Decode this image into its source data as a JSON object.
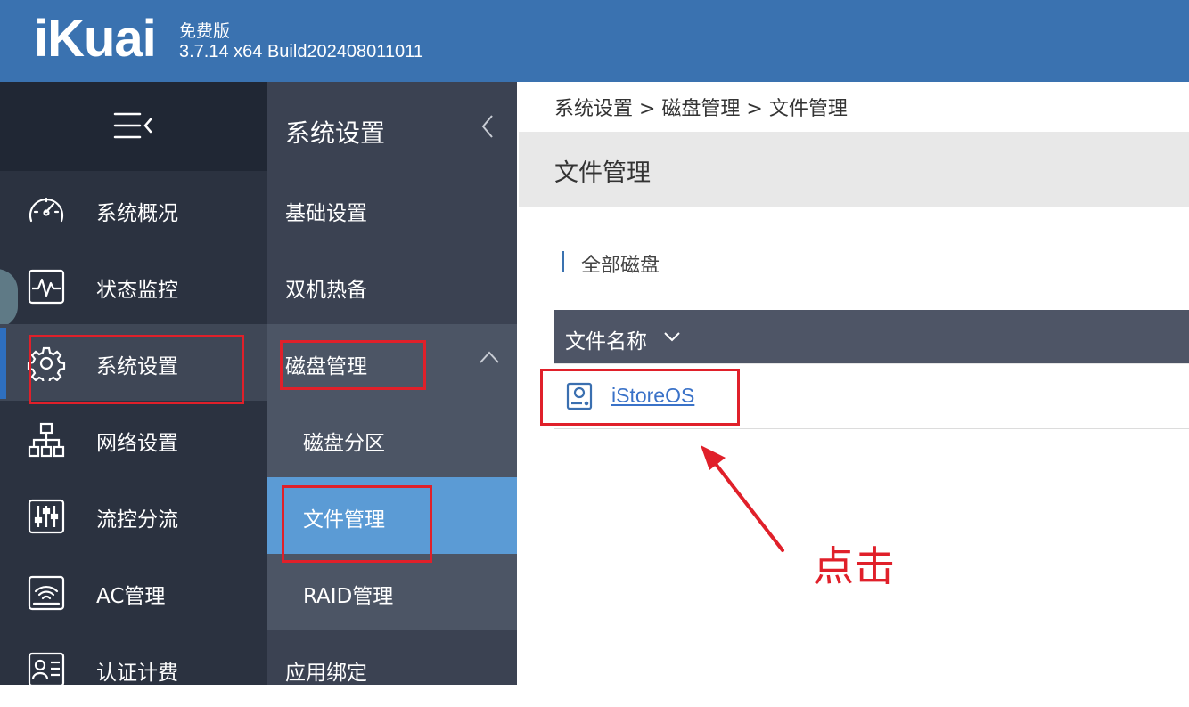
{
  "header": {
    "logo": "iKuai",
    "edition": "免费版",
    "build": "3.7.14 x64 Build202408011011"
  },
  "sidebar": {
    "items": [
      {
        "label": "系统概况",
        "icon": "dashboard-icon"
      },
      {
        "label": "状态监控",
        "icon": "monitor-icon"
      },
      {
        "label": "系统设置",
        "icon": "gear-icon"
      },
      {
        "label": "网络设置",
        "icon": "network-icon"
      },
      {
        "label": "流控分流",
        "icon": "sliders-icon"
      },
      {
        "label": "AC管理",
        "icon": "wifi-ac-icon"
      },
      {
        "label": "认证计费",
        "icon": "id-card-icon"
      }
    ]
  },
  "submenu": {
    "title": "系统设置",
    "items": [
      "基础设置",
      "双机热备",
      "磁盘管理",
      "磁盘分区",
      "文件管理",
      "RAID管理",
      "应用绑定"
    ]
  },
  "main": {
    "breadcrumb": "系统设置 > 磁盘管理 > 文件管理",
    "page_title": "文件管理",
    "section_title": "全部磁盘",
    "table": {
      "column": "文件名称",
      "rows": [
        {
          "name": "iStoreOS",
          "icon": "disk-icon"
        }
      ]
    }
  },
  "annotation": {
    "text": "点击",
    "color": "#e0202a"
  },
  "colors": {
    "header": "#3a72b0",
    "sidebar": "#2b3240",
    "submenu": "#3b4252",
    "selected": "#5b9bd5",
    "link": "#3a72c8"
  }
}
